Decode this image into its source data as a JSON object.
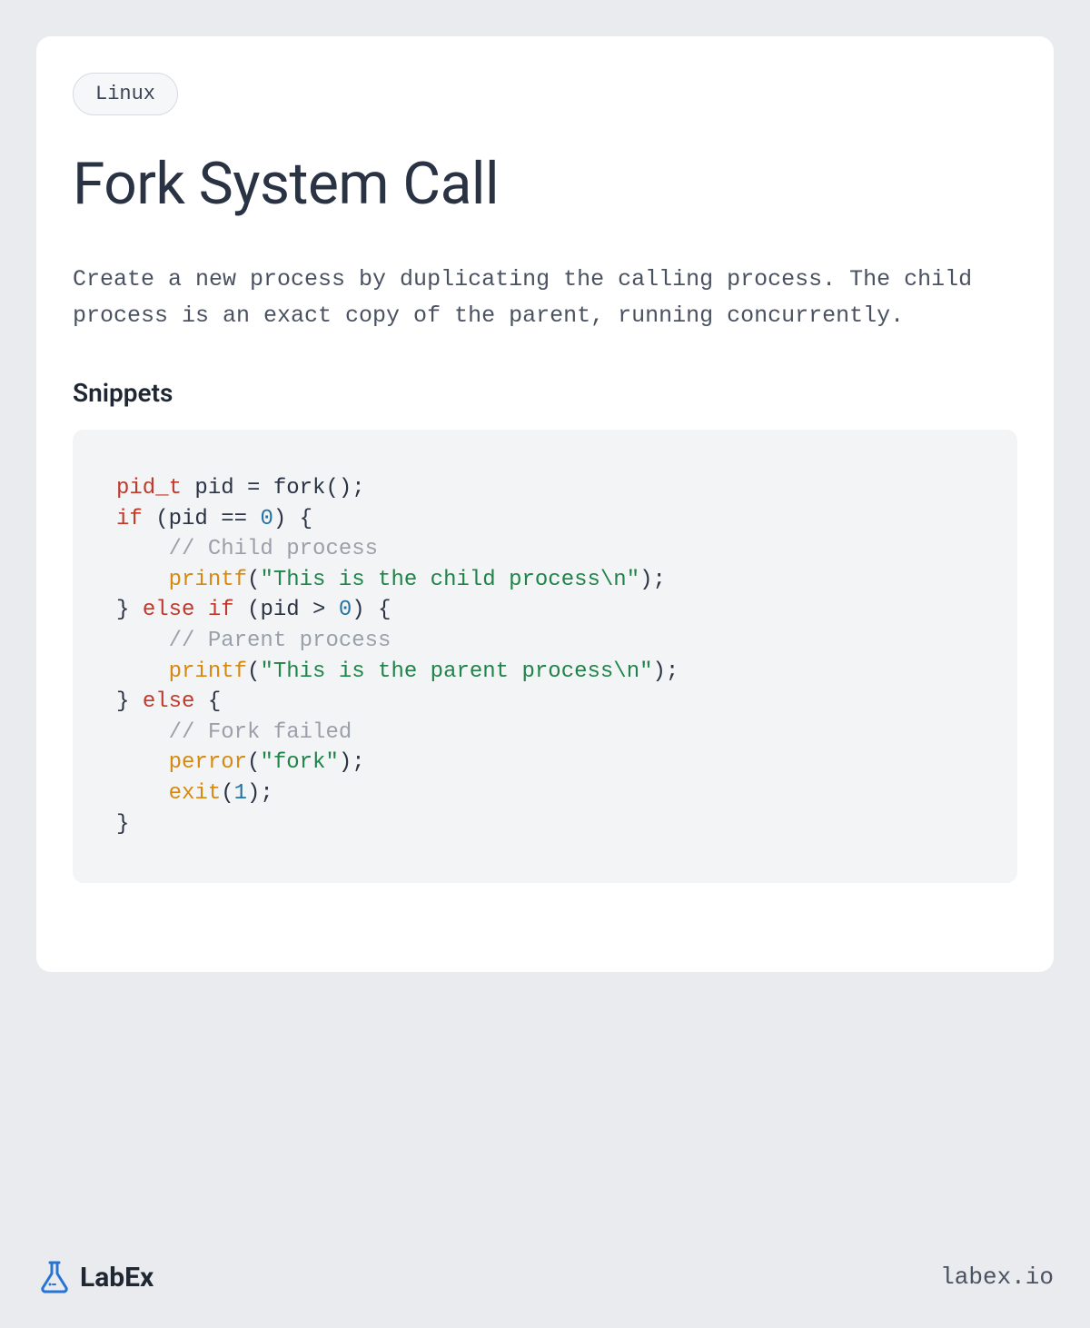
{
  "badge": "Linux",
  "title": "Fork System Call",
  "description": "Create a new process by duplicating the calling process. The child process is an exact copy of the parent, running concurrently.",
  "section_heading": "Snippets",
  "code": {
    "tokens": [
      {
        "t": "pid_t",
        "c": "tok-type"
      },
      {
        "t": " pid = fork();\n",
        "c": ""
      },
      {
        "t": "if",
        "c": "tok-keyword"
      },
      {
        "t": " (pid == ",
        "c": ""
      },
      {
        "t": "0",
        "c": "tok-number"
      },
      {
        "t": ") {\n    ",
        "c": ""
      },
      {
        "t": "// Child process",
        "c": "tok-comment"
      },
      {
        "t": "\n    ",
        "c": ""
      },
      {
        "t": "printf",
        "c": "tok-func"
      },
      {
        "t": "(",
        "c": ""
      },
      {
        "t": "\"This is the child process\\n\"",
        "c": "tok-string"
      },
      {
        "t": ");\n} ",
        "c": ""
      },
      {
        "t": "else",
        "c": "tok-keyword"
      },
      {
        "t": " ",
        "c": ""
      },
      {
        "t": "if",
        "c": "tok-keyword"
      },
      {
        "t": " (pid > ",
        "c": ""
      },
      {
        "t": "0",
        "c": "tok-number"
      },
      {
        "t": ") {\n    ",
        "c": ""
      },
      {
        "t": "// Parent process",
        "c": "tok-comment"
      },
      {
        "t": "\n    ",
        "c": ""
      },
      {
        "t": "printf",
        "c": "tok-func"
      },
      {
        "t": "(",
        "c": ""
      },
      {
        "t": "\"This is the parent process\\n\"",
        "c": "tok-string"
      },
      {
        "t": ");\n} ",
        "c": ""
      },
      {
        "t": "else",
        "c": "tok-keyword"
      },
      {
        "t": " {\n    ",
        "c": ""
      },
      {
        "t": "// Fork failed",
        "c": "tok-comment"
      },
      {
        "t": "\n    ",
        "c": ""
      },
      {
        "t": "perror",
        "c": "tok-func"
      },
      {
        "t": "(",
        "c": ""
      },
      {
        "t": "\"fork\"",
        "c": "tok-string"
      },
      {
        "t": ");\n    ",
        "c": ""
      },
      {
        "t": "exit",
        "c": "tok-func"
      },
      {
        "t": "(",
        "c": ""
      },
      {
        "t": "1",
        "c": "tok-number"
      },
      {
        "t": ");\n}",
        "c": ""
      }
    ]
  },
  "footer": {
    "brand": "LabEx",
    "url": "labex.io"
  }
}
